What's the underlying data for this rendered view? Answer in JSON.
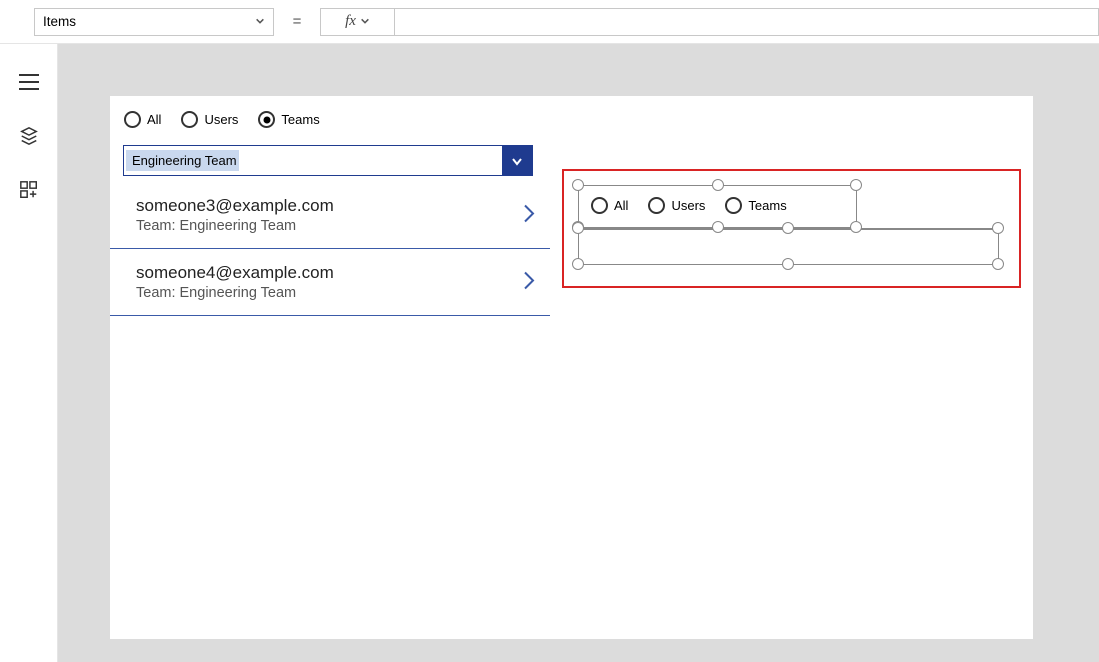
{
  "formula_bar": {
    "property": "Items",
    "equals": "=",
    "fx_label": "fx",
    "value": ""
  },
  "left_rail": {
    "items": [
      {
        "name": "menu-icon"
      },
      {
        "name": "screens-icon"
      },
      {
        "name": "components-icon"
      }
    ]
  },
  "canvas": {
    "filter_radios": {
      "options": [
        "All",
        "Users",
        "Teams"
      ],
      "selected": "Teams"
    },
    "dropdown": {
      "selected_text": "Engineering Team"
    },
    "results": [
      {
        "email": "someone3@example.com",
        "team_label": "Team: Engineering Team"
      },
      {
        "email": "someone4@example.com",
        "team_label": "Team: Engineering Team"
      }
    ],
    "designer_selection": {
      "mini_radios": [
        "All",
        "Users",
        "Teams"
      ]
    }
  }
}
